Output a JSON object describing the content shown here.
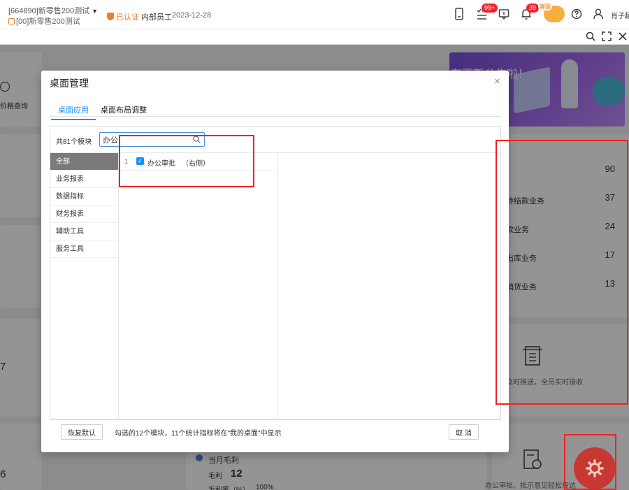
{
  "header": {
    "org_line1": "[664890]新零售200测试",
    "org_line2": "[00]新零售200测试",
    "certified": "已认证",
    "staff_label": "内部员工",
    "date": "2023-12-28",
    "task_badge": "99+",
    "notice_badge": "39",
    "avatar_label": "客服",
    "username": "肖子超"
  },
  "background": {
    "left_fragment": "价格查询",
    "banner_text": "有更新公告啦！",
    "stats": [
      {
        "label": "",
        "value": "90"
      },
      {
        "label": "待结款业务",
        "value": "37"
      },
      {
        "label": "款业务",
        "value": "24"
      },
      {
        "label": "出库业务",
        "value": "17"
      },
      {
        "label": "销货业务",
        "value": "13"
      }
    ],
    "push_text": "及时推送，全员实时接收",
    "left_num_1": "7",
    "left_num_2": "6",
    "profit_title": "当月毛利",
    "profit_label": "毛利",
    "profit_value": "12",
    "profit_rate_label": "毛利率（%）",
    "profit_rate_value": "100%",
    "approval_text": "办公审批，批示意见轻松传达"
  },
  "modal": {
    "title": "桌面管理",
    "tabs": [
      {
        "label": "桌面应用",
        "active": true
      },
      {
        "label": "桌面布局调整",
        "active": false
      }
    ],
    "module_count": "共81个模块",
    "search_value": "办公",
    "categories": [
      "全部",
      "业务报表",
      "数据指标",
      "财务报表",
      "辅助工具",
      "服务工具"
    ],
    "items": [
      {
        "index": "1",
        "name": "办公审批",
        "side": "（右侧）",
        "checked": true
      }
    ],
    "restore_button": "恢复默认",
    "footnote": "勾选的12个模块，11个统计指标将在\"我的桌面\"中显示",
    "cancel_button": "取 消"
  },
  "colors": {
    "accent": "#1890ff",
    "annotation": "#ee2222",
    "brand_orange": "#f07b2c",
    "fab": "#c73832"
  }
}
